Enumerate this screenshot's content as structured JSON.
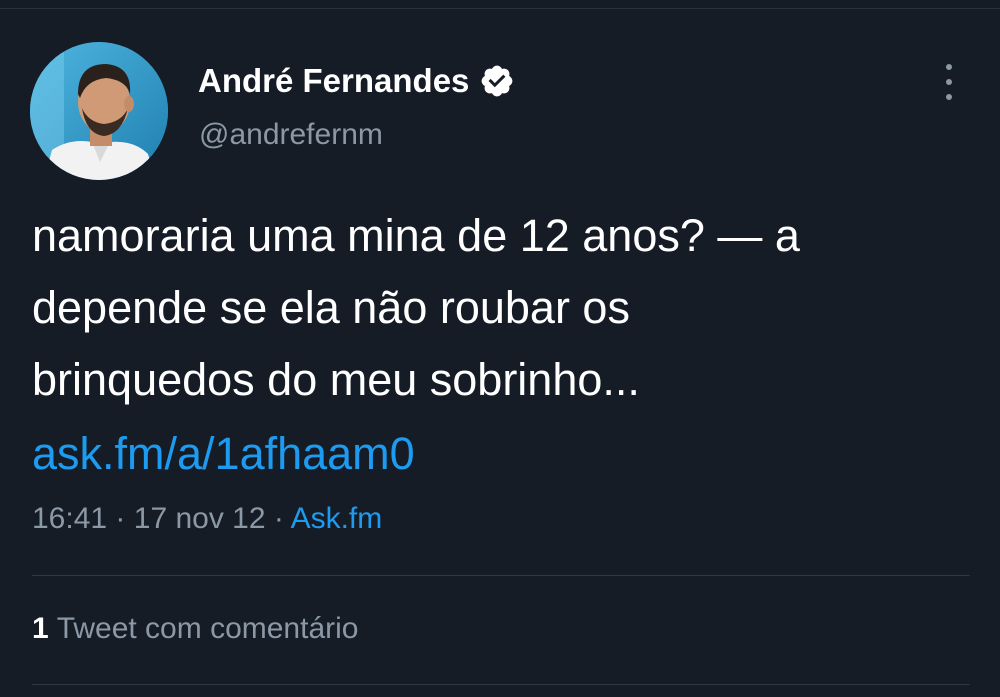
{
  "tweet": {
    "author": {
      "display_name": "André Fernandes",
      "handle": "@andrefernm",
      "verified": true
    },
    "text_lines": [
      "namoraria uma mina de 12 anos? — a",
      "depende se ela não roubar os",
      "brinquedos do meu sobrinho..."
    ],
    "link": "ask.fm/a/1afhaam0",
    "time": "16:41",
    "date": "17 nov 12",
    "separator": "·",
    "source": "Ask.fm"
  },
  "engagement": {
    "quote_count": "1",
    "quote_label": "Tweet com comentário"
  },
  "icons": {
    "verified": "verified-badge-icon",
    "more": "more-options-icon"
  },
  "colors": {
    "background": "#151c26",
    "link": "#1d9bf0",
    "secondary_text": "#8b98a5"
  }
}
